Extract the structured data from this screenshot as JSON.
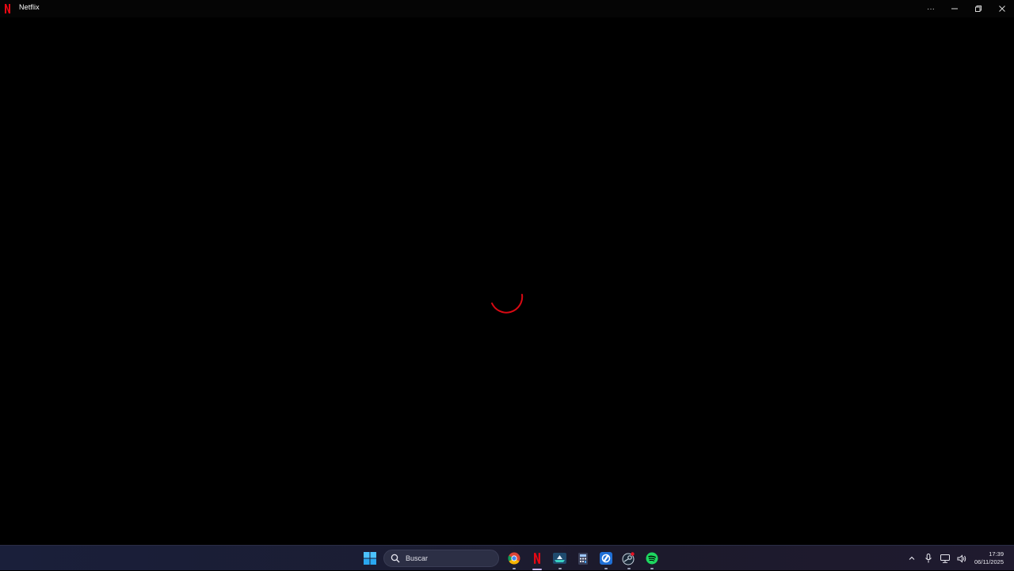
{
  "window": {
    "title": "Netflix",
    "controls": {
      "more_label": "···",
      "minimize_label": "—",
      "restore_label": "❐",
      "close_label": "✕"
    }
  },
  "content": {
    "state": "loading",
    "spinner_color": "#e50914"
  },
  "taskbar": {
    "search_placeholder": "Buscar",
    "pinned_apps": [
      {
        "name": "start",
        "icon": "windows-start-icon"
      },
      {
        "name": "chrome",
        "icon": "chrome-icon",
        "running": true
      },
      {
        "name": "netflix",
        "icon": "netflix-icon",
        "active": true
      },
      {
        "name": "vpn",
        "icon": "shield-ship-icon",
        "running": true
      },
      {
        "name": "calculator",
        "icon": "calculator-icon"
      },
      {
        "name": "app-blue",
        "icon": "blue-app-icon",
        "running": true
      },
      {
        "name": "steam",
        "icon": "steam-icon",
        "running": true,
        "badge": true
      },
      {
        "name": "spotify",
        "icon": "spotify-icon",
        "running": true
      }
    ],
    "tray": {
      "time": "17:39",
      "date": "06/11/2025"
    }
  },
  "colors": {
    "background": "#000000",
    "netflix_red": "#e50914",
    "taskbar": "#1c1d33"
  }
}
